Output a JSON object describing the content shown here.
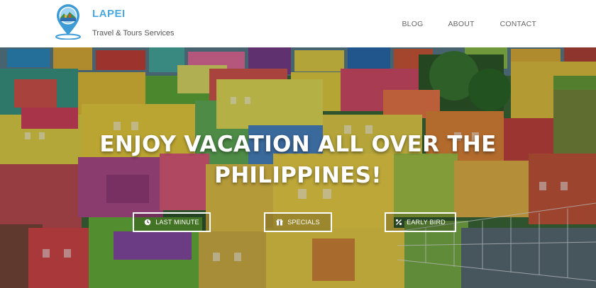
{
  "brand": {
    "name": "LAPEI",
    "tagline": "Travel & Tours Services",
    "accent_color": "#4aa8e0"
  },
  "nav": {
    "items": [
      {
        "label": "BLOG"
      },
      {
        "label": "ABOUT"
      },
      {
        "label": "CONTACT"
      }
    ]
  },
  "hero": {
    "headline_line1": "ENJOY VACATION ALL OVER THE",
    "headline_line2": "PHILIPPINES!",
    "background": "colorful-hillside-houses-photo",
    "buttons": [
      {
        "label": "LAST MINUTE",
        "icon": "clock-icon"
      },
      {
        "label": "SPECIALS",
        "icon": "gift-icon"
      },
      {
        "label": "EARLY BIRD",
        "icon": "percent-icon"
      }
    ]
  }
}
